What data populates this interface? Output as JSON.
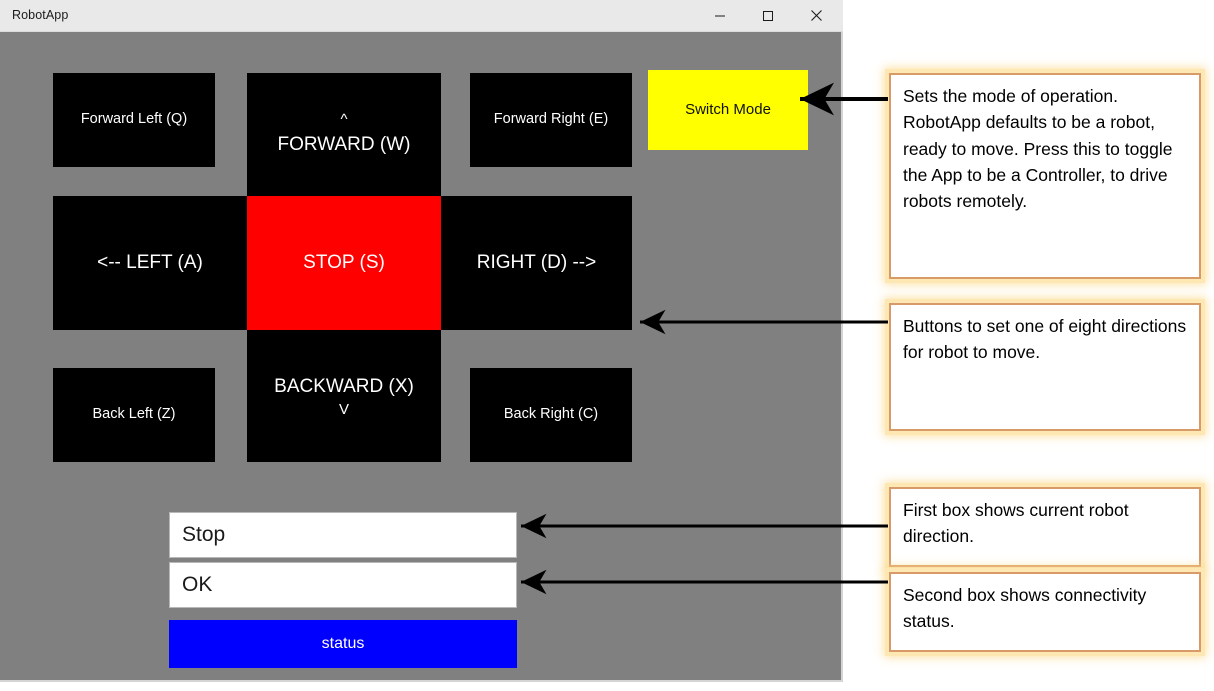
{
  "window": {
    "title": "RobotApp",
    "controls": [
      {
        "name": "minimize",
        "glyph": "minimize-icon"
      },
      {
        "name": "maximize",
        "glyph": "maximize-icon"
      },
      {
        "name": "close",
        "glyph": "close-icon"
      }
    ]
  },
  "colors": {
    "button_bg": "#000000",
    "button_text": "#ffffff",
    "stop_bg": "#ff0000",
    "switch_mode_bg": "#ffff00",
    "status_bg": "#0000ff",
    "app_bg": "#808080",
    "callout_border": "#d79a68",
    "callout_glow": "#fde8b4"
  },
  "controls": {
    "forward_left": "Forward Left (Q)",
    "forward_caret": "^",
    "forward": "FORWARD (W)",
    "forward_right": "Forward Right (E)",
    "switch_mode": "Switch Mode",
    "left": "<--   LEFT (A)",
    "stop": "STOP (S)",
    "right": "RIGHT (D) -->",
    "back_left": "Back Left (Z)",
    "backward": "BACKWARD (X)",
    "backward_caret": "V",
    "back_right": "Back Right (C)"
  },
  "status": {
    "direction_value": "Stop",
    "connection_value": "OK",
    "status_button": "status"
  },
  "callouts": {
    "switch_mode": "Sets the mode of operation. RobotApp defaults to be a robot, ready to move.  Press this to toggle the App to be a Controller, to drive robots remotely.",
    "directions": "Buttons to set one of eight directions for robot to move.",
    "first_box": "First box shows current robot direction.",
    "second_box": "Second box shows connectivity status."
  }
}
